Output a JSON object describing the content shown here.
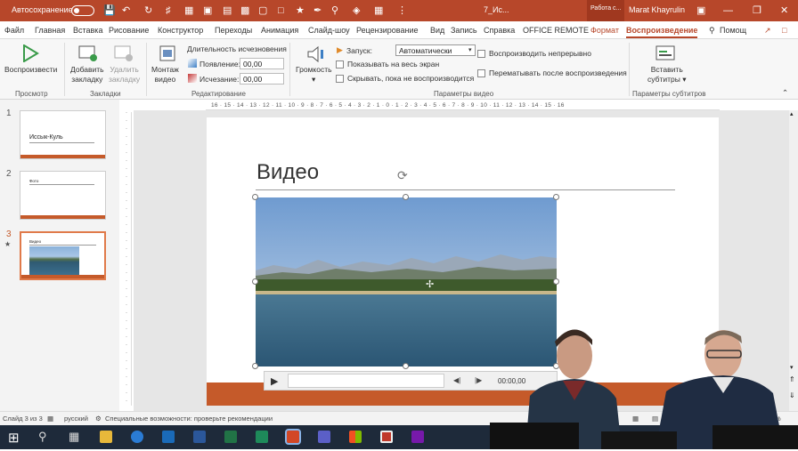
{
  "titlebar": {
    "autosave": "Автосохранение",
    "filename": "7_Ис...",
    "work_tab": "Работа с...",
    "user": "Marat Khayrulin"
  },
  "tabs": [
    "Файл",
    "Главная",
    "Вставка",
    "Рисование",
    "Конструктор",
    "Переходы",
    "Анимация",
    "Слайд-шоу",
    "Рецензирование",
    "Вид",
    "Запись",
    "Справка",
    "OFFICE REMOTE",
    "Формат",
    "Воспроизведение"
  ],
  "tell_me": "Помощ",
  "ribbon": {
    "play": "Воспроизвести",
    "add_bookmark_1": "Добавить",
    "add_bookmark_2": "закладку",
    "remove_bookmark_1": "Удалить",
    "remove_bookmark_2": "закладку",
    "trim_1": "Монтаж",
    "trim_2": "видео",
    "fade_duration": "Длительность исчезновения",
    "fade_in": "Появление:",
    "fade_in_value": "00,00",
    "fade_out": "Исчезание:",
    "fade_out_value": "00,00",
    "volume": "Громкость",
    "start": "Запуск:",
    "start_value": "Автоматически",
    "fullscreen": "Показывать на весь экран",
    "hide_not_playing": "Скрывать, пока не воспроизводится",
    "loop": "Воспроизводить непрерывно",
    "rewind": "Перематывать после воспроизведения",
    "insert_captions_1": "Вставить",
    "insert_captions_2": "субтитры",
    "groups": {
      "preview": "Просмотр",
      "bookmarks": "Закладки",
      "editing": "Редактирование",
      "video_options": "Параметры видео",
      "caption_options": "Параметры субтитров"
    }
  },
  "slides": [
    {
      "num": "1",
      "title": "Иссык-Куль"
    },
    {
      "num": "2",
      "title": "Фото"
    },
    {
      "num": "3",
      "title": "Видео"
    }
  ],
  "ruler_text": "16 · 15 · 14 · 13 · 12 · 11 · 10 · 9 · 8 · 7 · 6 · 5 · 4 · 3 · 2 · 1 · 0 · 1 · 2 · 3 · 4 · 5 · 6 · 7 · 8 · 9 · 10 · 11 · 12 · 13 · 14 · 15 · 16",
  "slide": {
    "title": "Видео"
  },
  "video": {
    "time": "00:00,00"
  },
  "status": {
    "slide_info": "Слайд 3 из 3",
    "language": "русский",
    "accessibility": "Специальные возможности: проверьте рекомендации",
    "zoom": "%"
  },
  "colors": {
    "accent": "#b7472a",
    "slide_bar": "#c55a2a",
    "taskbar": "#1e2a3a"
  }
}
